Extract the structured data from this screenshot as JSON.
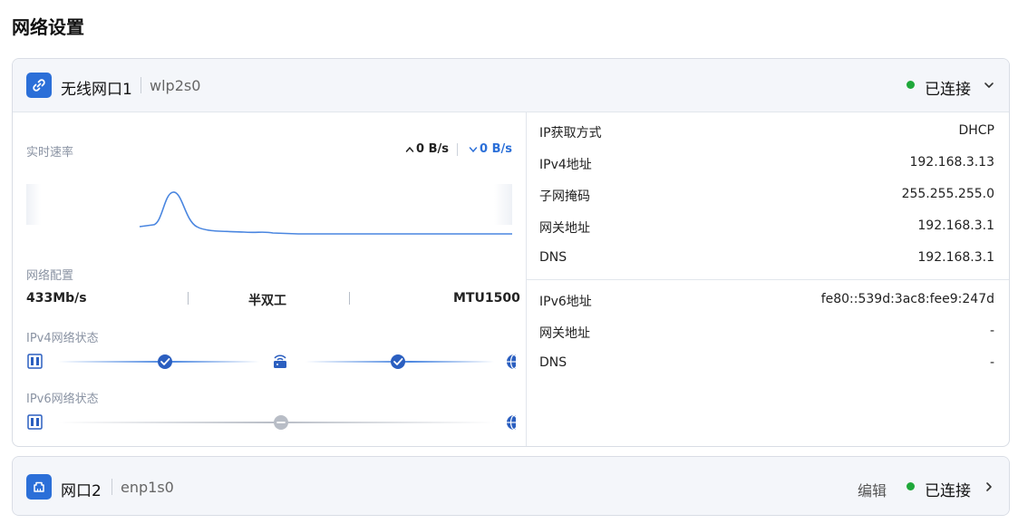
{
  "page": {
    "title": "网络设置"
  },
  "colors": {
    "accent": "#2b6fd8",
    "connected": "#1fa83a",
    "inactive": "#b8bdc6"
  },
  "interfaces": [
    {
      "name": "无线网口1",
      "device": "wlp2s0",
      "icon": "link-icon",
      "status": "已连接",
      "expanded": true,
      "realtime": {
        "label": "实时速率",
        "upload": "0 B/s",
        "download": "0 B/s"
      },
      "config": {
        "label": "网络配置",
        "speed": "433Mb/s",
        "duplex": "半双工",
        "mtu": "MTU1500"
      },
      "ipv4_status": {
        "label": "IPv4网络状态",
        "steps_ok": [
          true,
          true
        ]
      },
      "ipv6_status": {
        "label": "IPv6网络状态",
        "steps_ok": [
          false
        ]
      },
      "ipv4_info": [
        {
          "key": "IP获取方式",
          "value": "DHCP"
        },
        {
          "key": "IPv4地址",
          "value": "192.168.3.13"
        },
        {
          "key": "子网掩码",
          "value": "255.255.255.0"
        },
        {
          "key": "网关地址",
          "value": "192.168.3.1"
        },
        {
          "key": "DNS",
          "value": "192.168.3.1"
        }
      ],
      "ipv6_info": [
        {
          "key": "IPv6地址",
          "value": "fe80::539d:3ac8:fee9:247d"
        },
        {
          "key": "网关地址",
          "value": "-"
        },
        {
          "key": "DNS",
          "value": "-"
        }
      ]
    },
    {
      "name": "网口2",
      "device": "enp1s0",
      "icon": "ethernet-port-icon",
      "edit_label": "编辑",
      "status": "已连接",
      "expanded": false
    }
  ]
}
